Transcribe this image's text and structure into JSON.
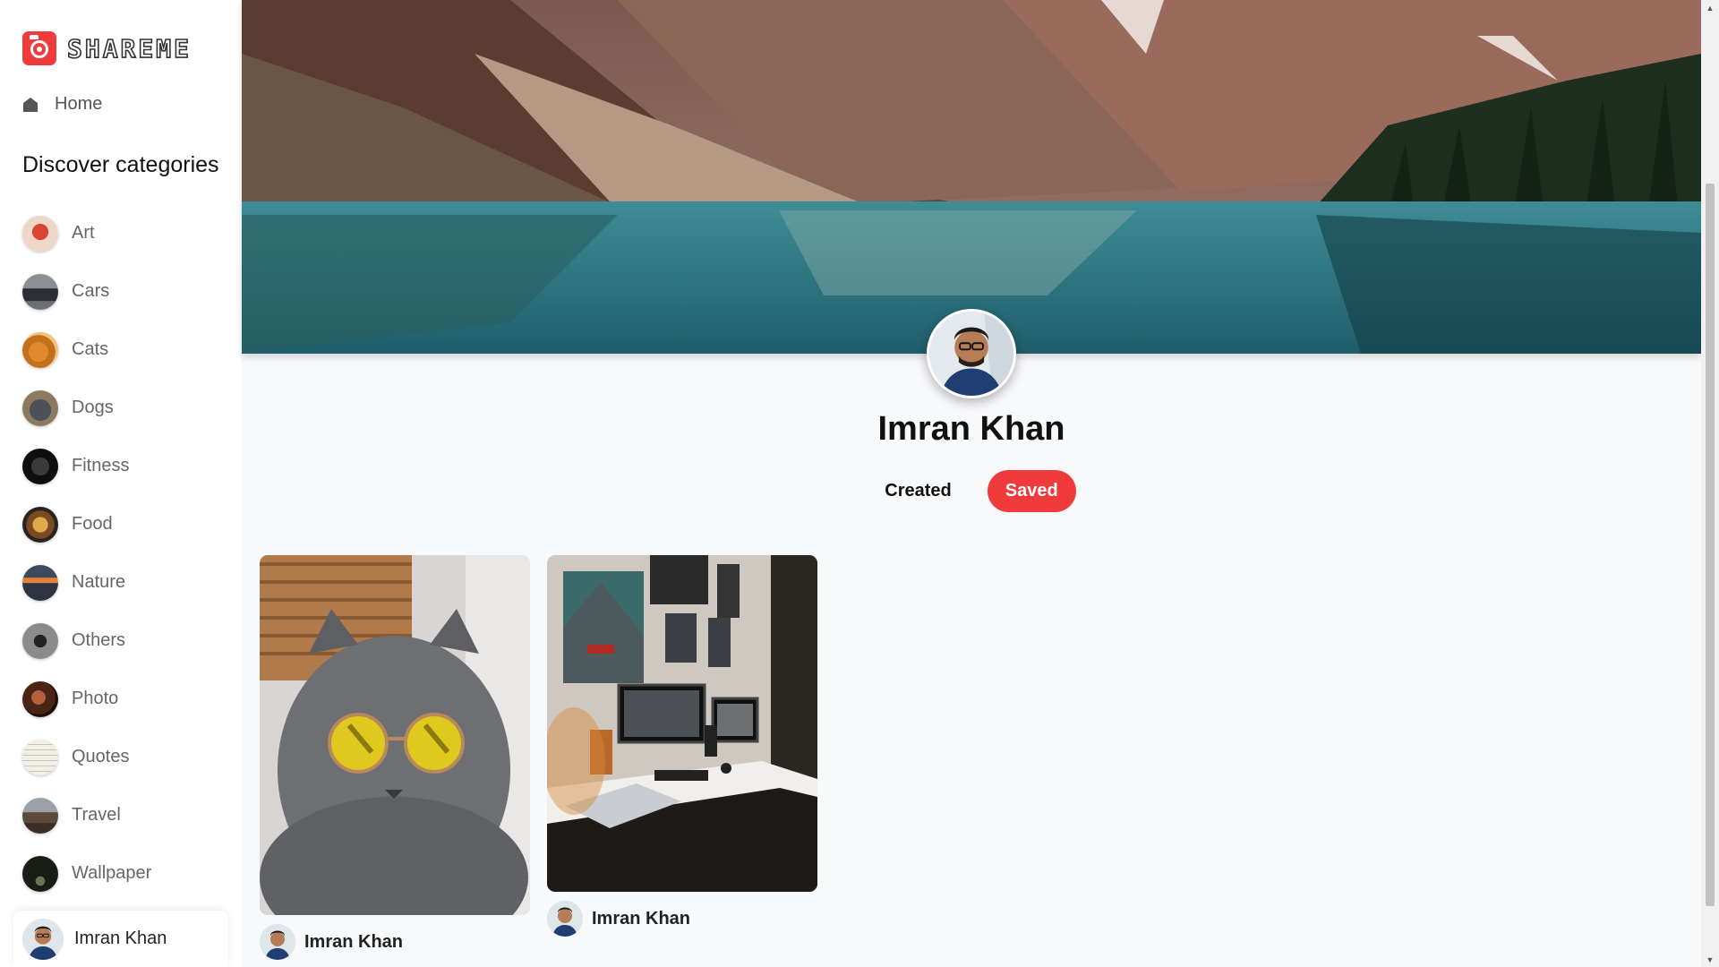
{
  "app": {
    "logo_text": "SHAREME",
    "brand_color": "#ef3b3b"
  },
  "sidebar": {
    "home_label": "Home",
    "discover_title": "Discover categories",
    "categories": [
      {
        "label": "Art"
      },
      {
        "label": "Cars"
      },
      {
        "label": "Cats"
      },
      {
        "label": "Dogs"
      },
      {
        "label": "Fitness"
      },
      {
        "label": "Food"
      },
      {
        "label": "Nature"
      },
      {
        "label": "Others"
      },
      {
        "label": "Photo"
      },
      {
        "label": "Quotes"
      },
      {
        "label": "Travel"
      },
      {
        "label": "Wallpaper"
      }
    ],
    "user": {
      "name": "Imran Khan"
    }
  },
  "profile": {
    "name": "Imran Khan",
    "tabs": {
      "created": "Created",
      "saved": "Saved"
    },
    "active_tab": "saved"
  },
  "pins": [
    {
      "subject": "grey cat wearing round yellow sunglasses",
      "author": "Imran Khan"
    },
    {
      "subject": "desk setup with monitors and laptop",
      "author": "Imran Khan"
    }
  ]
}
